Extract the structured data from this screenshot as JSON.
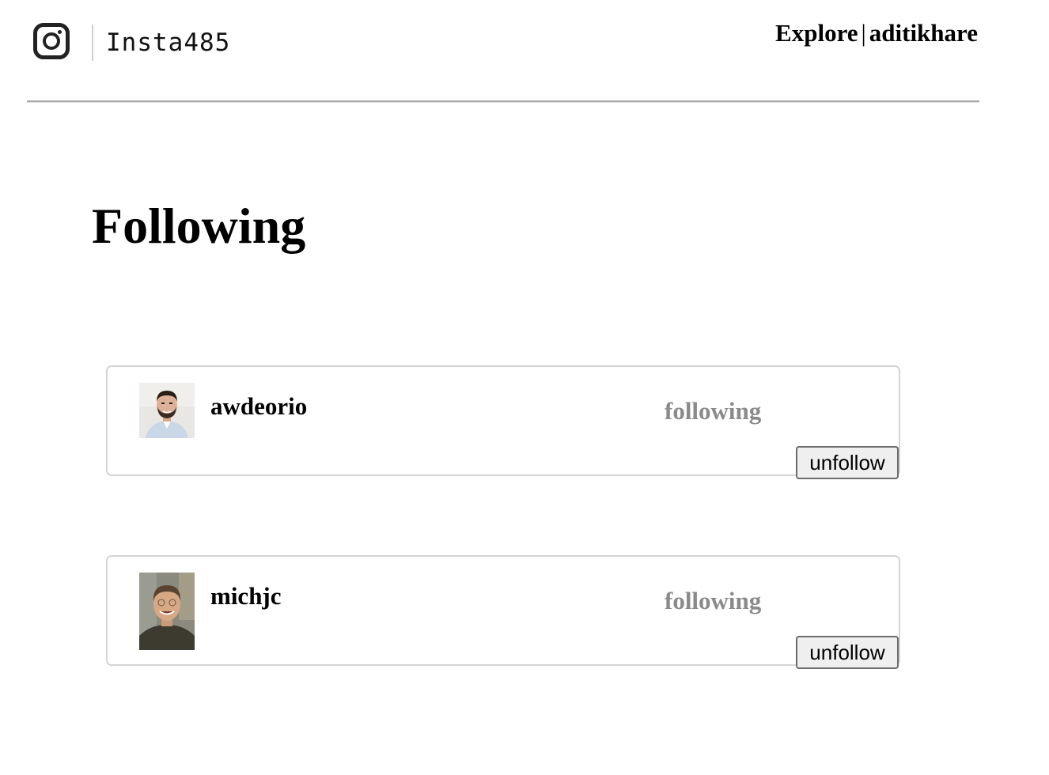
{
  "header": {
    "logo_icon": "instagram-camera-icon",
    "brand": "Insta485",
    "nav": {
      "explore_label": "Explore",
      "separator": "|",
      "user_label": "aditikhare"
    }
  },
  "page": {
    "title": "Following"
  },
  "following": [
    {
      "username": "awdeorio",
      "relation": "following",
      "button_label": "unfollow"
    },
    {
      "username": "michjc",
      "relation": "following",
      "button_label": "unfollow"
    }
  ],
  "colors": {
    "relation_text": "#8a8a8a",
    "card_border": "#d4d4d4",
    "button_bg": "#efefef",
    "header_rule": "#a9a9a9"
  }
}
